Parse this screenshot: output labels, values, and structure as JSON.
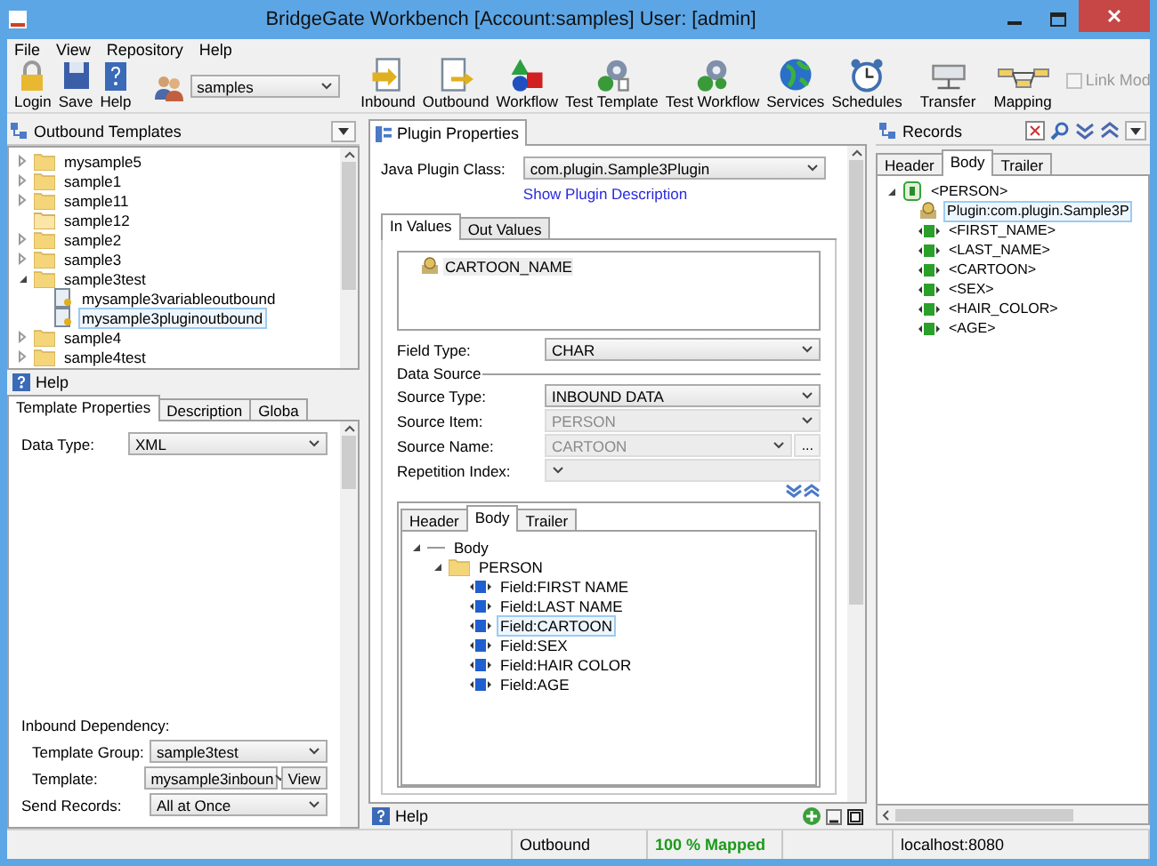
{
  "window": {
    "title": "BridgeGate Workbench [Account:samples] User: [admin]"
  },
  "menu": [
    "File",
    "View",
    "Repository",
    "Help"
  ],
  "toolbar": {
    "session_buttons": [
      "Login",
      "Save",
      "Help"
    ],
    "account": "samples",
    "tool_buttons": [
      "Inbound",
      "Outbound",
      "Workflow",
      "Test Template",
      "Test Workflow",
      "Services",
      "Schedules"
    ],
    "transfer_button": "Transfer",
    "mapping_button": "Mapping",
    "link_mode": {
      "label": "Link Mod",
      "checked": false,
      "disabled": true
    }
  },
  "left": {
    "templates": {
      "title": "Outbound Templates",
      "items": [
        {
          "label": "mysample5",
          "kind": "folder",
          "expanded": false,
          "selected": false
        },
        {
          "label": "sample1",
          "kind": "folder",
          "expanded": false,
          "selected": false
        },
        {
          "label": "sample11",
          "kind": "folder",
          "expanded": false,
          "selected": false
        },
        {
          "label": "sample12",
          "kind": "empty_folder",
          "selected": false
        },
        {
          "label": "sample2",
          "kind": "folder",
          "expanded": false,
          "selected": false
        },
        {
          "label": "sample3",
          "kind": "folder",
          "expanded": false,
          "selected": false
        },
        {
          "label": "sample3test",
          "kind": "folder",
          "expanded": true,
          "selected": false,
          "children": [
            {
              "label": "mysample3variableoutbound",
              "kind": "template",
              "selected": false
            },
            {
              "label": "mysample3pluginoutbound",
              "kind": "template",
              "selected": true
            }
          ]
        },
        {
          "label": "sample4",
          "kind": "folder",
          "expanded": false,
          "selected": false
        },
        {
          "label": "sample4test",
          "kind": "folder",
          "expanded": false,
          "selected": false
        }
      ]
    },
    "help": "Help",
    "properties": {
      "tabs": [
        {
          "label": "Template Properties",
          "selected": true
        },
        {
          "label": "Description",
          "selected": false
        },
        {
          "label": "Globa",
          "selected": false
        }
      ],
      "data_type": {
        "label": "Data Type:",
        "value": "XML"
      },
      "inbound_dependency": "Inbound Dependency:",
      "template_group": {
        "label": "Template Group:",
        "value": "sample3test"
      },
      "template": {
        "label": "Template:",
        "value": "mysample3inboun",
        "button": "View"
      },
      "send_records": {
        "label": "Send Records:",
        "value": "All at Once"
      }
    }
  },
  "center": {
    "tab": "Plugin Properties",
    "java_plugin_class": {
      "label": "Java Plugin Class:",
      "value": "com.plugin.Sample3Plugin"
    },
    "description_link": "Show Plugin Description",
    "value_tabs": [
      {
        "label": "In Values",
        "selected": true
      },
      {
        "label": "Out Values",
        "selected": false
      }
    ],
    "values": [
      {
        "label": "CARTOON_NAME",
        "selected": true
      }
    ],
    "field_type": {
      "label": "Field Type:",
      "value": "CHAR"
    },
    "data_source": {
      "title": "Data Source",
      "fields": [
        {
          "label": "Source Type:",
          "value": "INBOUND DATA",
          "disabled": false
        },
        {
          "label": "Source Item:",
          "value": "PERSON",
          "disabled": true
        },
        {
          "label": "Source Name:",
          "value": "CARTOON",
          "disabled": true,
          "browse": "..."
        },
        {
          "label": "Repetition Index:",
          "disabled": true
        }
      ]
    },
    "record_tabs": [
      {
        "label": "Header",
        "selected": false
      },
      {
        "label": "Body",
        "selected": true
      },
      {
        "label": "Trailer",
        "selected": false
      }
    ],
    "tree": [
      {
        "label": "Body",
        "kind": "group",
        "expanded": true,
        "selected": false,
        "children": [
          {
            "label": "PERSON",
            "kind": "folder",
            "expanded": true,
            "selected": false,
            "children": [
              {
                "label": "Field:FIRST NAME",
                "kind": "field",
                "selected": false
              },
              {
                "label": "Field:LAST NAME",
                "kind": "field",
                "selected": false
              },
              {
                "label": "Field:CARTOON",
                "kind": "field",
                "selected": true
              },
              {
                "label": "Field:SEX",
                "kind": "field",
                "selected": false
              },
              {
                "label": "Field:HAIR COLOR",
                "kind": "field",
                "selected": false
              },
              {
                "label": "Field:AGE",
                "kind": "field",
                "selected": false
              }
            ]
          }
        ]
      }
    ],
    "help": "Help"
  },
  "right": {
    "title": "Records",
    "tabs": [
      {
        "label": "Header",
        "selected": false
      },
      {
        "label": "Body",
        "selected": true
      },
      {
        "label": "Trailer",
        "selected": false
      }
    ],
    "tree": [
      {
        "label": "<PERSON>",
        "kind": "record",
        "expanded": true,
        "selected": false,
        "children": [
          {
            "label": "Plugin:com.plugin.Sample3P",
            "kind": "plugin",
            "selected": true
          },
          {
            "label": "<FIRST_NAME>",
            "kind": "element",
            "selected": false
          },
          {
            "label": "<LAST_NAME>",
            "kind": "element",
            "selected": false
          },
          {
            "label": "<CARTOON>",
            "kind": "element",
            "selected": false
          },
          {
            "label": "<SEX>",
            "kind": "element",
            "selected": false
          },
          {
            "label": "<HAIR_COLOR>",
            "kind": "element",
            "selected": false
          },
          {
            "label": "<AGE>",
            "kind": "element",
            "selected": false
          }
        ]
      }
    ]
  },
  "status_bar": [
    {
      "text": "Outbound",
      "kind": "plain"
    },
    {
      "text": "100 %  Mapped",
      "kind": "success"
    },
    {
      "text": "localhost:8080",
      "kind": "plain"
    }
  ]
}
